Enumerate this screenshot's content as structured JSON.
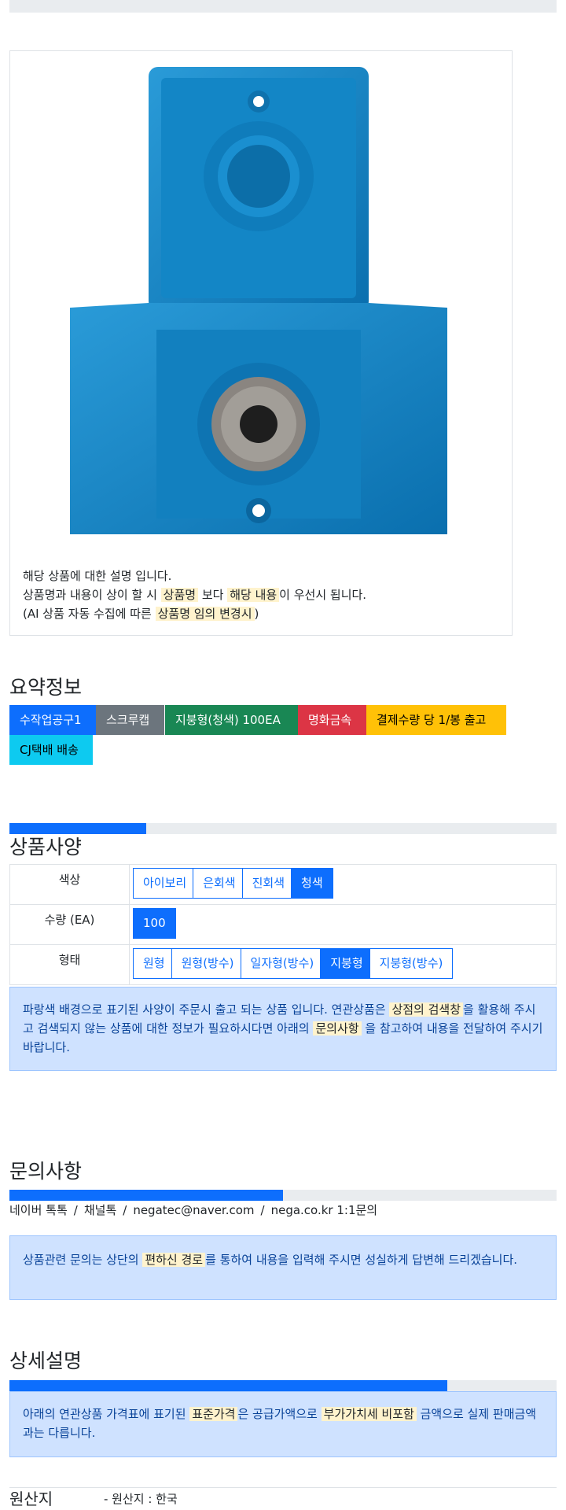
{
  "product_image": {
    "alt": "product-photo"
  },
  "description": {
    "line1": "해당 상품에 대한 설명 입니다.",
    "line2_a": "상품명과 내용이 상이 할 시 ",
    "line2_mark1": "상품명",
    "line2_b": " 보다 ",
    "line2_mark2": "해당 내용",
    "line2_c": "이 우선시 됩니다.",
    "line3_a": "(AI 상품 자동 수집에 따른 ",
    "line3_mark": "상품명 임의 변경시",
    "line3_b": ")"
  },
  "summary": {
    "title": "요약정보",
    "badges": [
      {
        "label": "수작업공구1",
        "color": "#0d6efd"
      },
      {
        "label": "스크루캡",
        "color": "#6c757d"
      },
      {
        "label": "지붕형(청색) 100EA",
        "color": "#198754"
      },
      {
        "label": "명화금속",
        "color": "#dc3545"
      },
      {
        "label": "결제수량 당 1/봉 출고",
        "color": "#ffc107"
      },
      {
        "label": "CJ택배 배송",
        "color": "#0dcaf0"
      }
    ]
  },
  "spec": {
    "progress": 25,
    "title": "상품사양",
    "rows": [
      {
        "label": "색상",
        "options": [
          "아이보리",
          "은회색",
          "진회색",
          "청색"
        ],
        "selected": "청색"
      },
      {
        "label": "수량 (EA)",
        "options": [
          "100"
        ],
        "selected": "100"
      },
      {
        "label": "형태",
        "options": [
          "원형",
          "원형(방수)",
          "일자형(방수)",
          "지붕형",
          "지붕형(방수)"
        ],
        "selected": "지붕형"
      }
    ],
    "notice_a": "파랑색 배경으로 표기된 사양이 주문시 출고 되는 상품 입니다. 연관상품은 ",
    "notice_mark1": "상점의 검색창",
    "notice_b": "을 활용해 주시고 검색되지 않는 상품에 대한 정보가 필요하시다면 아래의 ",
    "notice_mark2": "문의사항",
    "notice_c": " 을 참고하여 내용을 전달하여 주시기 바랍니다."
  },
  "inquiry": {
    "title": "문의사항",
    "progress": 50,
    "contacts": [
      "네이버 톡톡",
      "채널톡",
      "negatec@naver.com",
      "nega.co.kr 1:1문의"
    ],
    "separator": "/",
    "notice_a": "상품관련 문의는 상단의 ",
    "notice_mark": "편하신 경로",
    "notice_b": "를 통하여 내용을 입력해 주시면 성실하게 답변해 드리겠습니다."
  },
  "detail": {
    "title": "상세설명",
    "progress": 80,
    "notice_a": "아래의 연관상품 가격표에 표기된 ",
    "notice_mark1": "표준가격",
    "notice_b": "은 공급가액으로 ",
    "notice_mark2": "부가가치세 비포함",
    "notice_c": " 금액으로 실제 판매금액과는 다릅니다."
  },
  "origin": {
    "label": "원산지",
    "value": "- 원산지 : 한국"
  }
}
